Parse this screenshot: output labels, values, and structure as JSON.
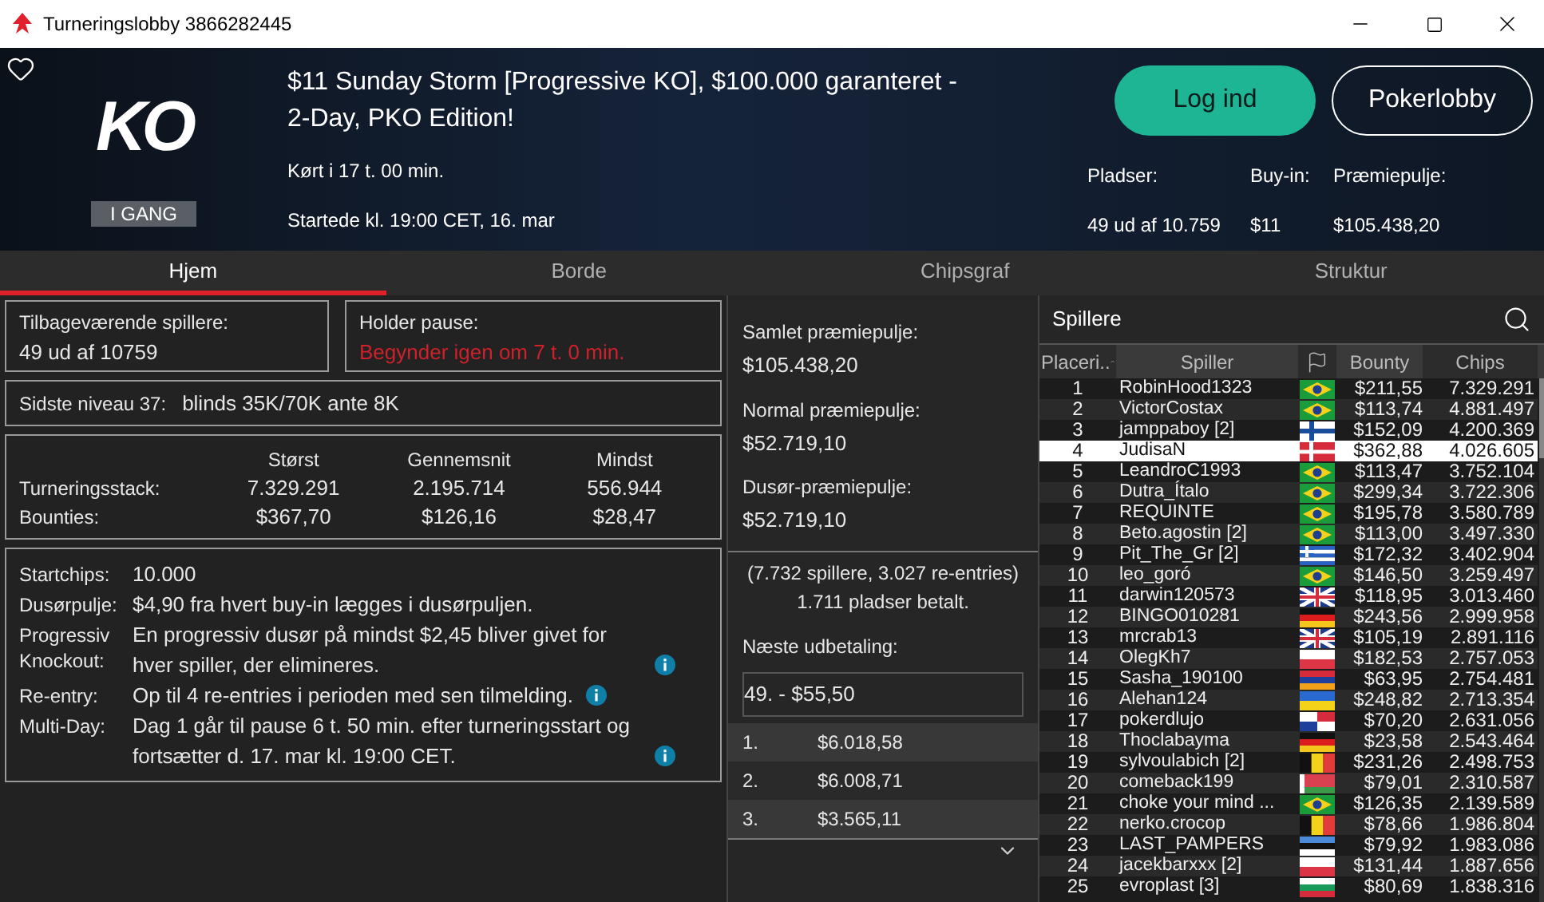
{
  "window": {
    "title": "Turneringslobby 3866282445"
  },
  "header": {
    "logo_text": "KO",
    "status": "I GANG",
    "title": "$11 Sunday Storm [Progressive KO], $100.000 garanteret - 2-Day, PKO Edition!",
    "run_time": "Kørt i 17 t. 00 min.",
    "started": "Startede kl. 19:00 CET, 16. mar",
    "buttons": [
      {
        "label": "Log ind",
        "kind": "primary"
      },
      {
        "label": "Pokerlobby",
        "kind": "outline"
      }
    ],
    "stats": [
      {
        "label": "Pladser:",
        "value": "49 ud af 10.759"
      },
      {
        "label": "Buy-in:",
        "value": "$11"
      },
      {
        "label": "Præmiepulje:",
        "value": "$105.438,20"
      }
    ]
  },
  "tabs": [
    {
      "label": "Hjem",
      "selected": true
    },
    {
      "label": "Borde",
      "selected": false
    },
    {
      "label": "Chipsgraf",
      "selected": false
    },
    {
      "label": "Struktur",
      "selected": false
    }
  ],
  "summary": {
    "remaining": {
      "label": "Tilbageværende spillere:",
      "value": "49 ud af 10759"
    },
    "break": {
      "label": "Holder pause:",
      "value": "Begynder igen om 7 t. 0 min."
    },
    "level": {
      "label": "Sidste niveau 37:",
      "value": "blinds 35K/70K ante 8K"
    },
    "stacks": {
      "columns": [
        "Størst",
        "Gennemsnit",
        "Mindst"
      ],
      "rows": [
        {
          "label": "Turneringsstack:",
          "values": [
            "7.329.291",
            "2.195.714",
            "556.944"
          ]
        },
        {
          "label": "Bounties:",
          "values": [
            "$367,70",
            "$126,16",
            "$28,47"
          ]
        }
      ]
    },
    "details": [
      {
        "label": "Startchips:",
        "value": "10.000",
        "info": false
      },
      {
        "label": "Dusørpulje:",
        "value": "$4,90 fra hvert buy-in lægges i dusørpuljen.",
        "info": false
      },
      {
        "label": "Progressiv Knockout:",
        "value": "En progressiv dusør på mindst $2,45 bliver givet for hver spiller, der elimineres.",
        "info": true
      },
      {
        "label": "Re-entry:",
        "value": "Op til 4 re-entries i perioden med sen tilmelding.",
        "info": true
      },
      {
        "label": "Multi-Day:",
        "value": "Dag 1 går til pause 6 t. 50 min. efter turneringsstart og fortsætter d. 17. mar kl. 19:00 CET.",
        "info": true
      }
    ]
  },
  "prizes": {
    "pools": [
      {
        "label": "Samlet præmiepulje:",
        "value": "$105.438,20"
      },
      {
        "label": "Normal præmiepulje:",
        "value": "$52.719,10"
      },
      {
        "label": "Dusør-præmiepulje:",
        "value": "$52.719,10"
      }
    ],
    "note": "(7.732 spillere, 3.027 re-entries)",
    "paid": "1.711 pladser betalt.",
    "next_label": "Næste udbetaling:",
    "next_value": "49. - $55,50",
    "payouts": [
      {
        "place": "1.",
        "amount": "$6.018,58"
      },
      {
        "place": "2.",
        "amount": "$6.008,71"
      },
      {
        "place": "3.",
        "amount": "$3.565,11"
      }
    ]
  },
  "players": {
    "title": "Spillere",
    "columns": {
      "rank": "Placeri..",
      "name": "Spiller",
      "bounty": "Bounty",
      "chips": "Chips"
    },
    "rows": [
      {
        "rank": "1",
        "name": "RobinHood1323",
        "kind": "br",
        "bounty": "$211,55",
        "chips": "7.329.291",
        "selected": false
      },
      {
        "rank": "2",
        "name": "VictorCostax",
        "kind": "br",
        "bounty": "$113,74",
        "chips": "4.881.497",
        "selected": false
      },
      {
        "rank": "3",
        "name": "jamppaboy [2]",
        "kind": "fi",
        "bounty": "$152,09",
        "chips": "4.200.369",
        "selected": false
      },
      {
        "rank": "4",
        "name": "JudisaN",
        "kind": "dk",
        "bounty": "$362,88",
        "chips": "4.026.605",
        "selected": true
      },
      {
        "rank": "5",
        "name": "LeandroC1993",
        "kind": "br",
        "bounty": "$113,47",
        "chips": "3.752.104",
        "selected": false
      },
      {
        "rank": "6",
        "name": "Dutra_Ítalo",
        "kind": "br",
        "bounty": "$299,34",
        "chips": "3.722.306",
        "selected": false
      },
      {
        "rank": "7",
        "name": "REQUINTE",
        "kind": "br",
        "bounty": "$195,78",
        "chips": "3.580.789",
        "selected": false
      },
      {
        "rank": "8",
        "name": "Beto.agostin [2]",
        "kind": "br",
        "bounty": "$113,00",
        "chips": "3.497.330",
        "selected": false
      },
      {
        "rank": "9",
        "name": "Pit_The_Gr [2]",
        "kind": "gr",
        "bounty": "$172,32",
        "chips": "3.402.904",
        "selected": false
      },
      {
        "rank": "10",
        "name": "leo_goró",
        "kind": "br",
        "bounty": "$146,50",
        "chips": "3.259.497",
        "selected": false
      },
      {
        "rank": "11",
        "name": "darwin120573",
        "kind": "gb",
        "bounty": "$118,95",
        "chips": "3.013.460",
        "selected": false
      },
      {
        "rank": "12",
        "name": "BINGO010281",
        "kind": "de",
        "bounty": "$243,56",
        "chips": "2.999.958",
        "selected": false
      },
      {
        "rank": "13",
        "name": "mrcrab13",
        "kind": "gb",
        "bounty": "$105,19",
        "chips": "2.891.116",
        "selected": false
      },
      {
        "rank": "14",
        "name": "OlegKh7",
        "kind": "pl",
        "bounty": "$182,53",
        "chips": "2.757.053",
        "selected": false
      },
      {
        "rank": "15",
        "name": "Sasha_190100",
        "kind": "am",
        "bounty": "$63,95",
        "chips": "2.754.481",
        "selected": false
      },
      {
        "rank": "16",
        "name": "Alehan124",
        "kind": "ua",
        "bounty": "$248,82",
        "chips": "2.713.354",
        "selected": false
      },
      {
        "rank": "17",
        "name": "pokerdlujo",
        "kind": "pa",
        "bounty": "$70,20",
        "chips": "2.631.056",
        "selected": false
      },
      {
        "rank": "18",
        "name": "Thoclabayma",
        "kind": "de",
        "bounty": "$23,58",
        "chips": "2.543.464",
        "selected": false
      },
      {
        "rank": "19",
        "name": "sylvoulabich [2]",
        "kind": "be",
        "bounty": "$231,26",
        "chips": "2.498.753",
        "selected": false
      },
      {
        "rank": "20",
        "name": "comeback199",
        "kind": "by",
        "bounty": "$79,01",
        "chips": "2.310.587",
        "selected": false
      },
      {
        "rank": "21",
        "name": "choke your mind ...",
        "kind": "br",
        "bounty": "$126,35",
        "chips": "2.139.589",
        "selected": false
      },
      {
        "rank": "22",
        "name": "nerko.crocop",
        "kind": "be",
        "bounty": "$78,66",
        "chips": "1.986.804",
        "selected": false
      },
      {
        "rank": "23",
        "name": "LAST_PAMPERS",
        "kind": "ee",
        "bounty": "$79,92",
        "chips": "1.983.086",
        "selected": false
      },
      {
        "rank": "24",
        "name": "jacekbarxxx [2]",
        "kind": "pl",
        "bounty": "$131,44",
        "chips": "1.887.656",
        "selected": false
      },
      {
        "rank": "25",
        "name": "evroplast [3]",
        "kind": "bg",
        "bounty": "$80,69",
        "chips": "1.838.316",
        "selected": false
      }
    ]
  }
}
